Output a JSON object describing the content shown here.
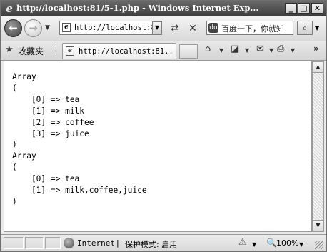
{
  "window": {
    "title": "http://localhost:81/5-1.php - Windows Internet Exp...",
    "app_icon": "ie-logo-icon",
    "controls": {
      "minimize": "_",
      "maximize": "□",
      "close": "✕"
    }
  },
  "toolbar": {
    "back_glyph": "←",
    "forward_glyph": "→",
    "history_dropdown_glyph": "▼",
    "address": "http://localhost:8",
    "address_dropdown_glyph": "▼",
    "refresh_glyph": "⇄",
    "stop_glyph": "✕",
    "search_text": "百度一下，你就知",
    "search_logo": "du",
    "search_go_glyph": "⌕",
    "search_dropdown_glyph": "▼"
  },
  "favorites": {
    "star_glyph": "★",
    "label": "收藏夹",
    "tab_title": "http://localhost:81...",
    "home_glyph": "⌂",
    "feed_glyph": "◪",
    "mail_glyph": "✉",
    "print_glyph": "⎙",
    "dropdown_glyph": "▼",
    "more_glyph": "»"
  },
  "page": {
    "output": "Array\n(\n    [0] => tea\n    [1] => milk\n    [2] => coffee\n    [3] => juice\n)\nArray\n(\n    [0] => tea\n    [1] => milk,coffee,juice\n)"
  },
  "scrollbar": {
    "up_glyph": "▲",
    "down_glyph": "▼"
  },
  "status": {
    "zone": "Internet",
    "separator": "|",
    "protected_mode": "保护模式: 启用",
    "security_glyph": "⚠",
    "zoom_glyph": "🔍",
    "zoom": "100%",
    "dropdown_glyph": "▼"
  }
}
